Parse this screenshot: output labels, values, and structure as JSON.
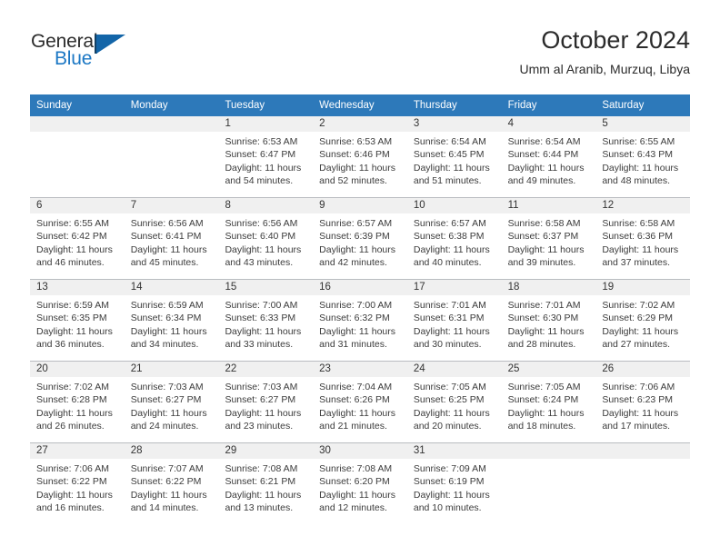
{
  "brand": {
    "name_part1": "General",
    "name_part2": "Blue",
    "accent_color": "#1b77c4",
    "logo_triangle_color": "#1365a8"
  },
  "header": {
    "title": "October 2024",
    "subtitle": "Umm al Aranib, Murzuq, Libya"
  },
  "theme": {
    "header_row_bg": "#2d79ba",
    "day_band_bg": "#f0f0f0",
    "grid_line": "#b9bcc0",
    "text": "#333333"
  },
  "calendar": {
    "weekday_headers": [
      "Sunday",
      "Monday",
      "Tuesday",
      "Wednesday",
      "Thursday",
      "Friday",
      "Saturday"
    ],
    "weeks": [
      [
        {
          "day": "",
          "empty": true
        },
        {
          "day": "",
          "empty": true
        },
        {
          "day": "1",
          "sunrise": "Sunrise: 6:53 AM",
          "sunset": "Sunset: 6:47 PM",
          "daylight_line1": "Daylight: 11 hours",
          "daylight_line2": "and 54 minutes."
        },
        {
          "day": "2",
          "sunrise": "Sunrise: 6:53 AM",
          "sunset": "Sunset: 6:46 PM",
          "daylight_line1": "Daylight: 11 hours",
          "daylight_line2": "and 52 minutes."
        },
        {
          "day": "3",
          "sunrise": "Sunrise: 6:54 AM",
          "sunset": "Sunset: 6:45 PM",
          "daylight_line1": "Daylight: 11 hours",
          "daylight_line2": "and 51 minutes."
        },
        {
          "day": "4",
          "sunrise": "Sunrise: 6:54 AM",
          "sunset": "Sunset: 6:44 PM",
          "daylight_line1": "Daylight: 11 hours",
          "daylight_line2": "and 49 minutes."
        },
        {
          "day": "5",
          "sunrise": "Sunrise: 6:55 AM",
          "sunset": "Sunset: 6:43 PM",
          "daylight_line1": "Daylight: 11 hours",
          "daylight_line2": "and 48 minutes."
        }
      ],
      [
        {
          "day": "6",
          "sunrise": "Sunrise: 6:55 AM",
          "sunset": "Sunset: 6:42 PM",
          "daylight_line1": "Daylight: 11 hours",
          "daylight_line2": "and 46 minutes."
        },
        {
          "day": "7",
          "sunrise": "Sunrise: 6:56 AM",
          "sunset": "Sunset: 6:41 PM",
          "daylight_line1": "Daylight: 11 hours",
          "daylight_line2": "and 45 minutes."
        },
        {
          "day": "8",
          "sunrise": "Sunrise: 6:56 AM",
          "sunset": "Sunset: 6:40 PM",
          "daylight_line1": "Daylight: 11 hours",
          "daylight_line2": "and 43 minutes."
        },
        {
          "day": "9",
          "sunrise": "Sunrise: 6:57 AM",
          "sunset": "Sunset: 6:39 PM",
          "daylight_line1": "Daylight: 11 hours",
          "daylight_line2": "and 42 minutes."
        },
        {
          "day": "10",
          "sunrise": "Sunrise: 6:57 AM",
          "sunset": "Sunset: 6:38 PM",
          "daylight_line1": "Daylight: 11 hours",
          "daylight_line2": "and 40 minutes."
        },
        {
          "day": "11",
          "sunrise": "Sunrise: 6:58 AM",
          "sunset": "Sunset: 6:37 PM",
          "daylight_line1": "Daylight: 11 hours",
          "daylight_line2": "and 39 minutes."
        },
        {
          "day": "12",
          "sunrise": "Sunrise: 6:58 AM",
          "sunset": "Sunset: 6:36 PM",
          "daylight_line1": "Daylight: 11 hours",
          "daylight_line2": "and 37 minutes."
        }
      ],
      [
        {
          "day": "13",
          "sunrise": "Sunrise: 6:59 AM",
          "sunset": "Sunset: 6:35 PM",
          "daylight_line1": "Daylight: 11 hours",
          "daylight_line2": "and 36 minutes."
        },
        {
          "day": "14",
          "sunrise": "Sunrise: 6:59 AM",
          "sunset": "Sunset: 6:34 PM",
          "daylight_line1": "Daylight: 11 hours",
          "daylight_line2": "and 34 minutes."
        },
        {
          "day": "15",
          "sunrise": "Sunrise: 7:00 AM",
          "sunset": "Sunset: 6:33 PM",
          "daylight_line1": "Daylight: 11 hours",
          "daylight_line2": "and 33 minutes."
        },
        {
          "day": "16",
          "sunrise": "Sunrise: 7:00 AM",
          "sunset": "Sunset: 6:32 PM",
          "daylight_line1": "Daylight: 11 hours",
          "daylight_line2": "and 31 minutes."
        },
        {
          "day": "17",
          "sunrise": "Sunrise: 7:01 AM",
          "sunset": "Sunset: 6:31 PM",
          "daylight_line1": "Daylight: 11 hours",
          "daylight_line2": "and 30 minutes."
        },
        {
          "day": "18",
          "sunrise": "Sunrise: 7:01 AM",
          "sunset": "Sunset: 6:30 PM",
          "daylight_line1": "Daylight: 11 hours",
          "daylight_line2": "and 28 minutes."
        },
        {
          "day": "19",
          "sunrise": "Sunrise: 7:02 AM",
          "sunset": "Sunset: 6:29 PM",
          "daylight_line1": "Daylight: 11 hours",
          "daylight_line2": "and 27 minutes."
        }
      ],
      [
        {
          "day": "20",
          "sunrise": "Sunrise: 7:02 AM",
          "sunset": "Sunset: 6:28 PM",
          "daylight_line1": "Daylight: 11 hours",
          "daylight_line2": "and 26 minutes."
        },
        {
          "day": "21",
          "sunrise": "Sunrise: 7:03 AM",
          "sunset": "Sunset: 6:27 PM",
          "daylight_line1": "Daylight: 11 hours",
          "daylight_line2": "and 24 minutes."
        },
        {
          "day": "22",
          "sunrise": "Sunrise: 7:03 AM",
          "sunset": "Sunset: 6:27 PM",
          "daylight_line1": "Daylight: 11 hours",
          "daylight_line2": "and 23 minutes."
        },
        {
          "day": "23",
          "sunrise": "Sunrise: 7:04 AM",
          "sunset": "Sunset: 6:26 PM",
          "daylight_line1": "Daylight: 11 hours",
          "daylight_line2": "and 21 minutes."
        },
        {
          "day": "24",
          "sunrise": "Sunrise: 7:05 AM",
          "sunset": "Sunset: 6:25 PM",
          "daylight_line1": "Daylight: 11 hours",
          "daylight_line2": "and 20 minutes."
        },
        {
          "day": "25",
          "sunrise": "Sunrise: 7:05 AM",
          "sunset": "Sunset: 6:24 PM",
          "daylight_line1": "Daylight: 11 hours",
          "daylight_line2": "and 18 minutes."
        },
        {
          "day": "26",
          "sunrise": "Sunrise: 7:06 AM",
          "sunset": "Sunset: 6:23 PM",
          "daylight_line1": "Daylight: 11 hours",
          "daylight_line2": "and 17 minutes."
        }
      ],
      [
        {
          "day": "27",
          "sunrise": "Sunrise: 7:06 AM",
          "sunset": "Sunset: 6:22 PM",
          "daylight_line1": "Daylight: 11 hours",
          "daylight_line2": "and 16 minutes."
        },
        {
          "day": "28",
          "sunrise": "Sunrise: 7:07 AM",
          "sunset": "Sunset: 6:22 PM",
          "daylight_line1": "Daylight: 11 hours",
          "daylight_line2": "and 14 minutes."
        },
        {
          "day": "29",
          "sunrise": "Sunrise: 7:08 AM",
          "sunset": "Sunset: 6:21 PM",
          "daylight_line1": "Daylight: 11 hours",
          "daylight_line2": "and 13 minutes."
        },
        {
          "day": "30",
          "sunrise": "Sunrise: 7:08 AM",
          "sunset": "Sunset: 6:20 PM",
          "daylight_line1": "Daylight: 11 hours",
          "daylight_line2": "and 12 minutes."
        },
        {
          "day": "31",
          "sunrise": "Sunrise: 7:09 AM",
          "sunset": "Sunset: 6:19 PM",
          "daylight_line1": "Daylight: 11 hours",
          "daylight_line2": "and 10 minutes."
        },
        {
          "day": "",
          "empty": true
        },
        {
          "day": "",
          "empty": true
        }
      ]
    ]
  }
}
